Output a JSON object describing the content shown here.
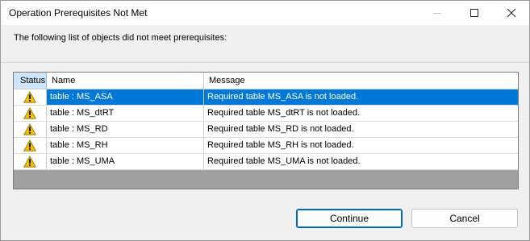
{
  "window": {
    "title": "Operation Prerequisites Not Met"
  },
  "intro_text": "The following list of objects did not meet prerequisites:",
  "table": {
    "columns": [
      "Status",
      "Name",
      "Message"
    ],
    "rows": [
      {
        "status_icon": "warning-icon",
        "name": "table : MS_ASA",
        "message": "Required table MS_ASA is not loaded.",
        "selected": true
      },
      {
        "status_icon": "warning-icon",
        "name": "table : MS_dtRT",
        "message": "Required table MS_dtRT is not loaded.",
        "selected": false
      },
      {
        "status_icon": "warning-icon",
        "name": "table : MS_RD",
        "message": "Required table MS_RD is not loaded.",
        "selected": false
      },
      {
        "status_icon": "warning-icon",
        "name": "table : MS_RH",
        "message": "Required table MS_RH is not loaded.",
        "selected": false
      },
      {
        "status_icon": "warning-icon",
        "name": "table : MS_UMA",
        "message": "Required table MS_UMA is not loaded.",
        "selected": false
      }
    ]
  },
  "buttons": {
    "continue_label": "Continue",
    "cancel_label": "Cancel"
  },
  "colors": {
    "selection": "#0078d7",
    "warning": "#f2c200",
    "accent_border": "#0067c0"
  }
}
